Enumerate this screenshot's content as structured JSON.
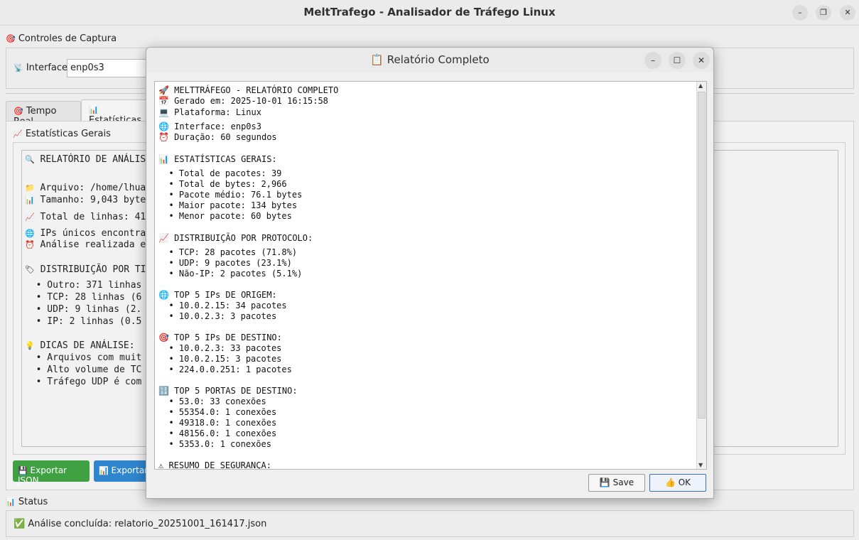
{
  "window": {
    "title": "MeltTrafego - Analisador de Tráfego Linux",
    "minimize": "–",
    "maximize": "❐",
    "close": "✕"
  },
  "capture": {
    "section_title": "Controles de Captura",
    "interface_label": "Interface:",
    "interface_value": "enp0s3"
  },
  "tabs": [
    {
      "label": "Tempo Real",
      "active": false
    },
    {
      "label": "Estatísticas",
      "active": true
    }
  ],
  "stats": {
    "section_title": "Estatísticas Gerais",
    "lines": [
      "RELATÓRIO DE ANÁLIS",
      "",
      "Arquivo: /home/lhua",
      "Tamanho: 9,043 byte",
      "Total de linhas: 41",
      "IPs únicos encontra",
      "Análise realizada e",
      "",
      "DISTRIBUIÇÃO POR TI",
      "  • Outro: 371 linhas",
      "  • TCP: 28 linhas (6",
      "  • UDP: 9 linhas (2.",
      "  • IP: 2 linhas (0.5",
      "",
      "DICAS DE ANÁLISE:",
      "  • Arquivos com muit",
      "  • Alto volume de TC",
      "  • Tráfego UDP é com"
    ]
  },
  "buttons": {
    "export_json": "Exportar JSON",
    "export_other": "Exportar"
  },
  "status": {
    "section_title": "Status",
    "message": "Análise concluída: relatorio_20251001_161417.json"
  },
  "dialog": {
    "title": "Relatório Completo",
    "minimize": "–",
    "maximize": "☐",
    "close": "✕",
    "save_label": "Save",
    "ok_label": "OK",
    "report_lines": [
      "🚀 MELTTRÁFEGO - RELATÓRIO COMPLETO",
      "📅 Gerado em: 2025-10-01 16:15:58",
      "💻 Plataforma: Linux",
      "🌐 Interface: enp0s3",
      "⏰ Duração: 60 segundos",
      "📊 ESTATÍSTICAS GERAIS:",
      "  • Total de pacotes: 39",
      "  • Total de bytes: 2,966",
      "  • Pacote médio: 76.1 bytes",
      "  • Maior pacote: 134 bytes",
      "  • Menor pacote: 60 bytes",
      "📈 DISTRIBUIÇÃO POR PROTOCOLO:",
      "  • TCP: 28 pacotes (71.8%)",
      "  • UDP: 9 pacotes (23.1%)",
      "  • Não-IP: 2 pacotes (5.1%)",
      "🌐 TOP 5 IPs DE ORIGEM:",
      "  • 10.0.2.15: 34 pacotes",
      "  • 10.0.2.3: 3 pacotes",
      "🎯 TOP 5 IPs DE DESTINO:",
      "  • 10.0.2.3: 33 pacotes",
      "  • 10.0.2.15: 3 pacotes",
      "  • 224.0.0.251: 1 pacotes",
      "🔢 TOP 5 PORTAS DE DESTINO:",
      "  • 53.0: 33 conexões",
      "  • 55354.0: 1 conexões",
      "  • 49318.0: 1 conexões",
      "  • 48156.0: 1 conexões",
      "  • 5353.0: 1 conexões",
      "⚠ RESUMO DE SEGURANÇA:"
    ]
  },
  "colors": {
    "export_json_bg": "#3fa142",
    "export_other_bg": "#2f86cf"
  }
}
